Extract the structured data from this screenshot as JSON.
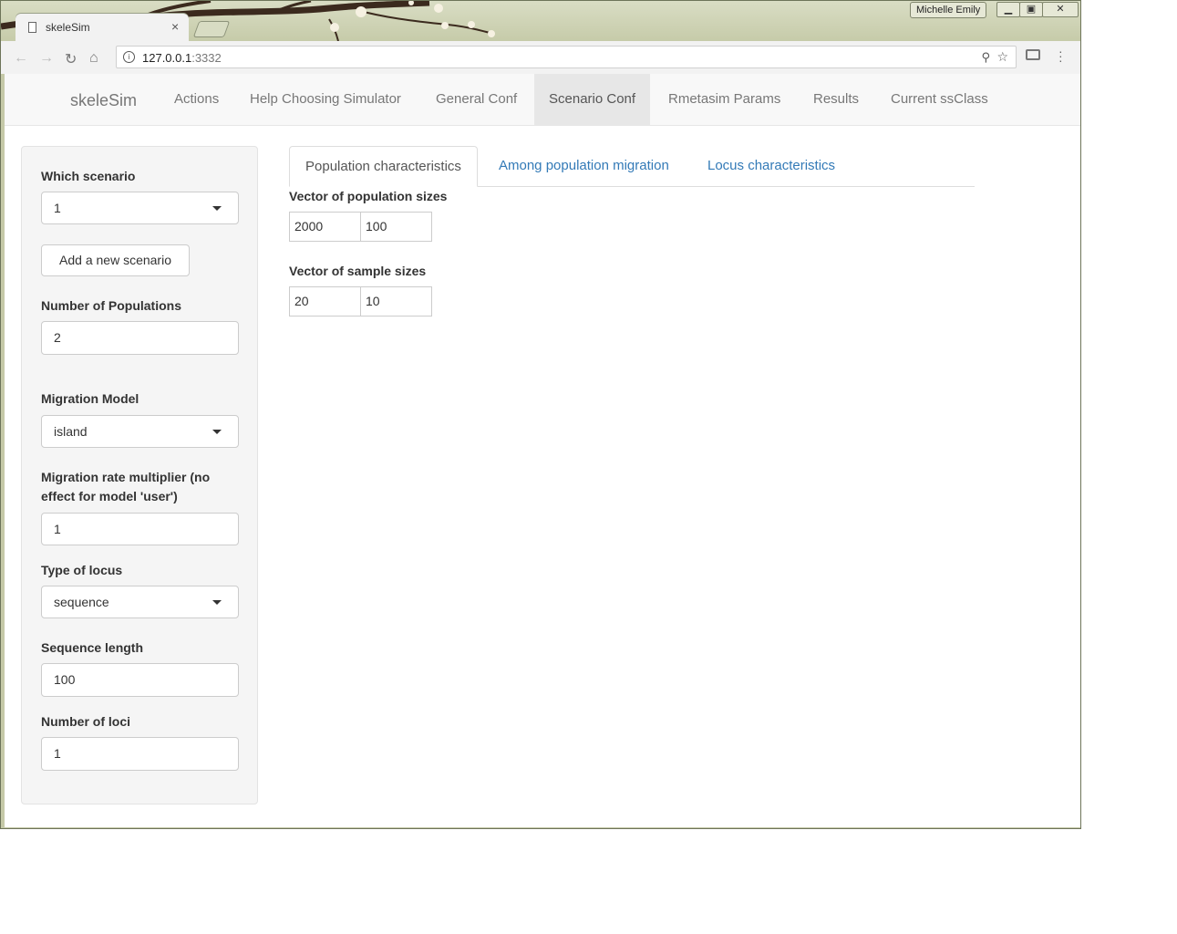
{
  "browser": {
    "tab_title": "skeleSim",
    "tab_close": "×",
    "user_name": "Michelle Emily",
    "url_host": "127.0.0.1",
    "url_port": ":3332",
    "icons": [
      "page-icon",
      "close-icon",
      "back-icon",
      "forward-icon",
      "reload-icon",
      "home-icon",
      "info-icon",
      "zoom-icon",
      "star-icon",
      "cast-icon",
      "menu-icon"
    ]
  },
  "navbar": {
    "brand": "skeleSim",
    "items": [
      {
        "label": "Actions"
      },
      {
        "label": "Help Choosing Simulator"
      },
      {
        "label": "General Conf"
      },
      {
        "label": "Scenario Conf",
        "active": true
      },
      {
        "label": "Rmetasim Params"
      },
      {
        "label": "Results"
      },
      {
        "label": "Current ssClass"
      }
    ]
  },
  "sidebar": {
    "which_scenario_label": "Which scenario",
    "which_scenario_value": "1",
    "add_scenario_button": "Add a new scenario",
    "num_pops_label": "Number of Populations",
    "num_pops_value": "2",
    "migration_model_label": "Migration Model",
    "migration_model_value": "island",
    "migration_rate_label_1": "Migration rate multiplier (no",
    "migration_rate_label_2": "effect for model 'user')",
    "migration_rate_value": "1",
    "locus_type_label": "Type of locus",
    "locus_type_value": "sequence",
    "seq_length_label": "Sequence length",
    "seq_length_value": "100",
    "num_loci_label": "Number of loci",
    "num_loci_value": "1"
  },
  "main": {
    "tabs": [
      {
        "label": "Population characteristics",
        "active": true
      },
      {
        "label": "Among population migration"
      },
      {
        "label": "Locus characteristics"
      }
    ],
    "pop_sizes_label": "Vector of population sizes",
    "pop_sizes": [
      "2000",
      "100"
    ],
    "sample_sizes_label": "Vector of sample sizes",
    "sample_sizes": [
      "20",
      "10"
    ]
  }
}
